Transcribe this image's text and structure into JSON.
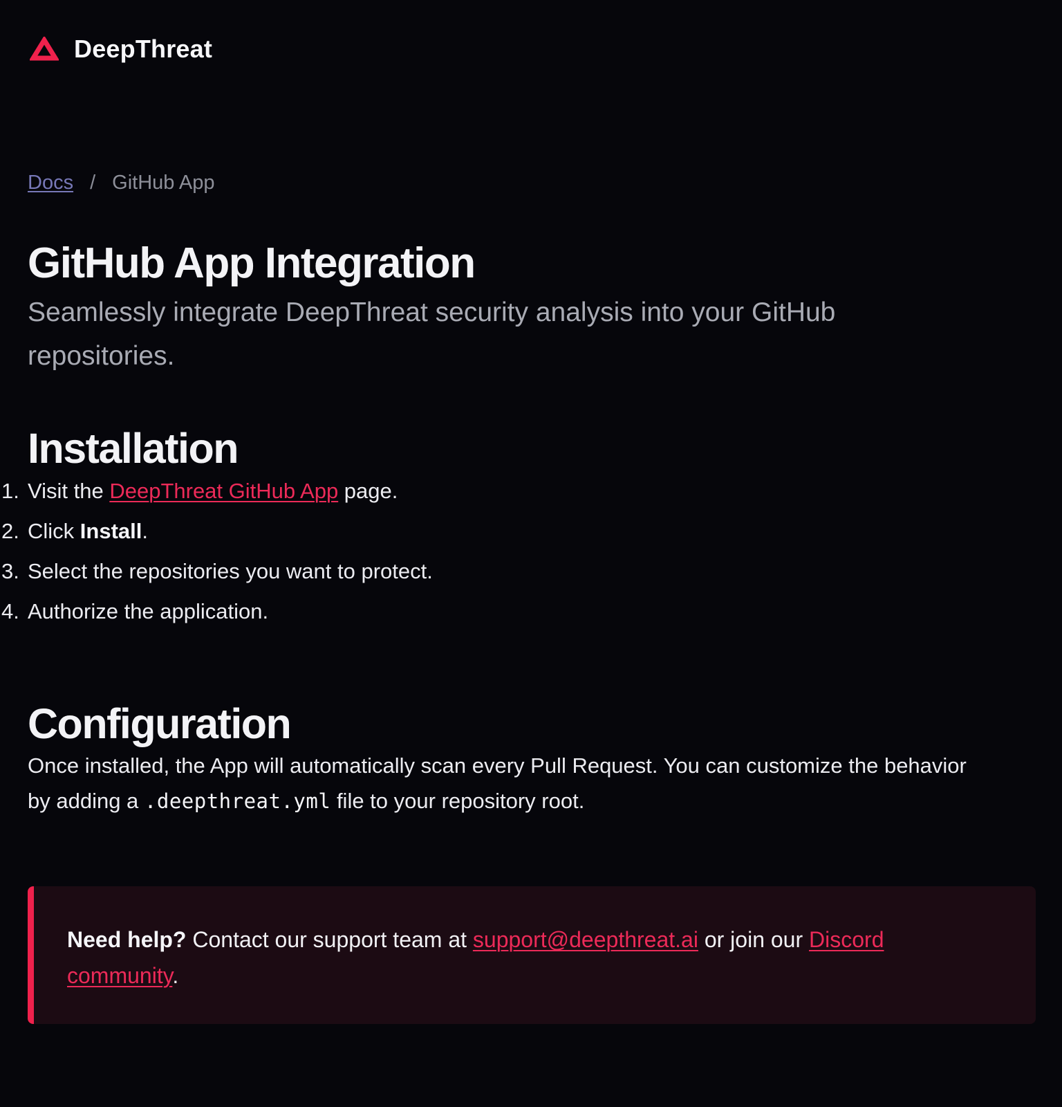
{
  "header": {
    "brand": "DeepThreat",
    "logo_icon": "triangle-icon",
    "accent_color": "#f0214c"
  },
  "breadcrumb": {
    "items": [
      {
        "label": "Docs",
        "link": true
      },
      {
        "label": "GitHub App",
        "link": false
      }
    ],
    "separator": "/"
  },
  "page": {
    "title": "GitHub App Integration",
    "subtitle": "Seamlessly integrate DeepThreat security analysis into your GitHub repositories."
  },
  "installation": {
    "title": "Installation",
    "steps": [
      {
        "number": "1.",
        "prefix": "Visit the ",
        "link": "DeepThreat GitHub App",
        "suffix": " page."
      },
      {
        "number": "2.",
        "prefix": "Click ",
        "strong": "Install",
        "suffix": "."
      },
      {
        "number": "3.",
        "text": "Select the repositories you want to protect."
      },
      {
        "number": "4.",
        "text": "Authorize the application."
      }
    ]
  },
  "configuration": {
    "title": "Configuration",
    "text_before": "Once installed, the App will automatically scan every Pull Request. You can customize the behavior by adding a ",
    "code": ".deepthreat.yml",
    "text_after": " file to your repository root."
  },
  "callout": {
    "strong": "Need help?",
    "text_1": " Contact our support team at ",
    "email_link": "support@deepthreat.ai",
    "text_2": " or join our ",
    "community_link": "Discord community",
    "text_3": ".",
    "background_color": "#1c0b13",
    "border_color": "#f0214c"
  }
}
